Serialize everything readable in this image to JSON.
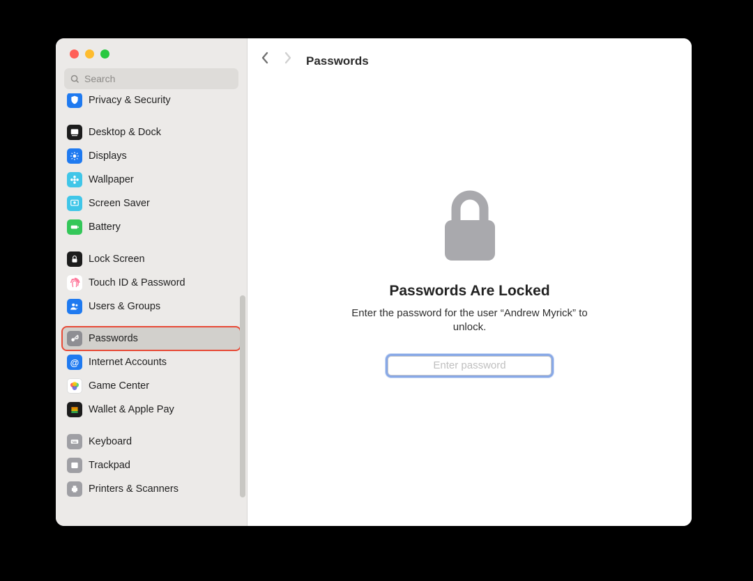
{
  "window": {
    "search_placeholder": "Search",
    "page_title": "Passwords"
  },
  "sidebar": {
    "items": [
      {
        "label": "Privacy & Security",
        "icon": "hand-icon",
        "bg": "#1f7af0"
      },
      {
        "label": "Desktop & Dock",
        "icon": "dock-icon",
        "bg": "#1c1c1c"
      },
      {
        "label": "Displays",
        "icon": "sun-icon",
        "bg": "#1f7af0"
      },
      {
        "label": "Wallpaper",
        "icon": "flower-icon",
        "bg": "#40c6e8"
      },
      {
        "label": "Screen Saver",
        "icon": "screensaver-icon",
        "bg": "#40c6e8"
      },
      {
        "label": "Battery",
        "icon": "battery-icon",
        "bg": "#34c759"
      },
      {
        "label": "Lock Screen",
        "icon": "lockscreen-icon",
        "bg": "#1c1c1c"
      },
      {
        "label": "Touch ID & Password",
        "icon": "fingerprint-icon",
        "bg": "#ff5e88"
      },
      {
        "label": "Users & Groups",
        "icon": "users-icon",
        "bg": "#1f7af0"
      },
      {
        "label": "Passwords",
        "icon": "key-icon",
        "bg": "#8e8e93"
      },
      {
        "label": "Internet Accounts",
        "icon": "at-icon",
        "bg": "#1f7af0"
      },
      {
        "label": "Game Center",
        "icon": "gamecenter-icon",
        "bg": "#ffffff"
      },
      {
        "label": "Wallet & Apple Pay",
        "icon": "wallet-icon",
        "bg": "#1c1c1c"
      },
      {
        "label": "Keyboard",
        "icon": "keyboard-icon",
        "bg": "#9f9fa4"
      },
      {
        "label": "Trackpad",
        "icon": "trackpad-icon",
        "bg": "#9f9fa4"
      },
      {
        "label": "Printers & Scanners",
        "icon": "printer-icon",
        "bg": "#9f9fa4"
      }
    ],
    "selected_index": 9
  },
  "main": {
    "heading": "Passwords Are Locked",
    "subtext": "Enter the password for the user “Andrew Myrick” to unlock.",
    "password_placeholder": "Enter password"
  }
}
